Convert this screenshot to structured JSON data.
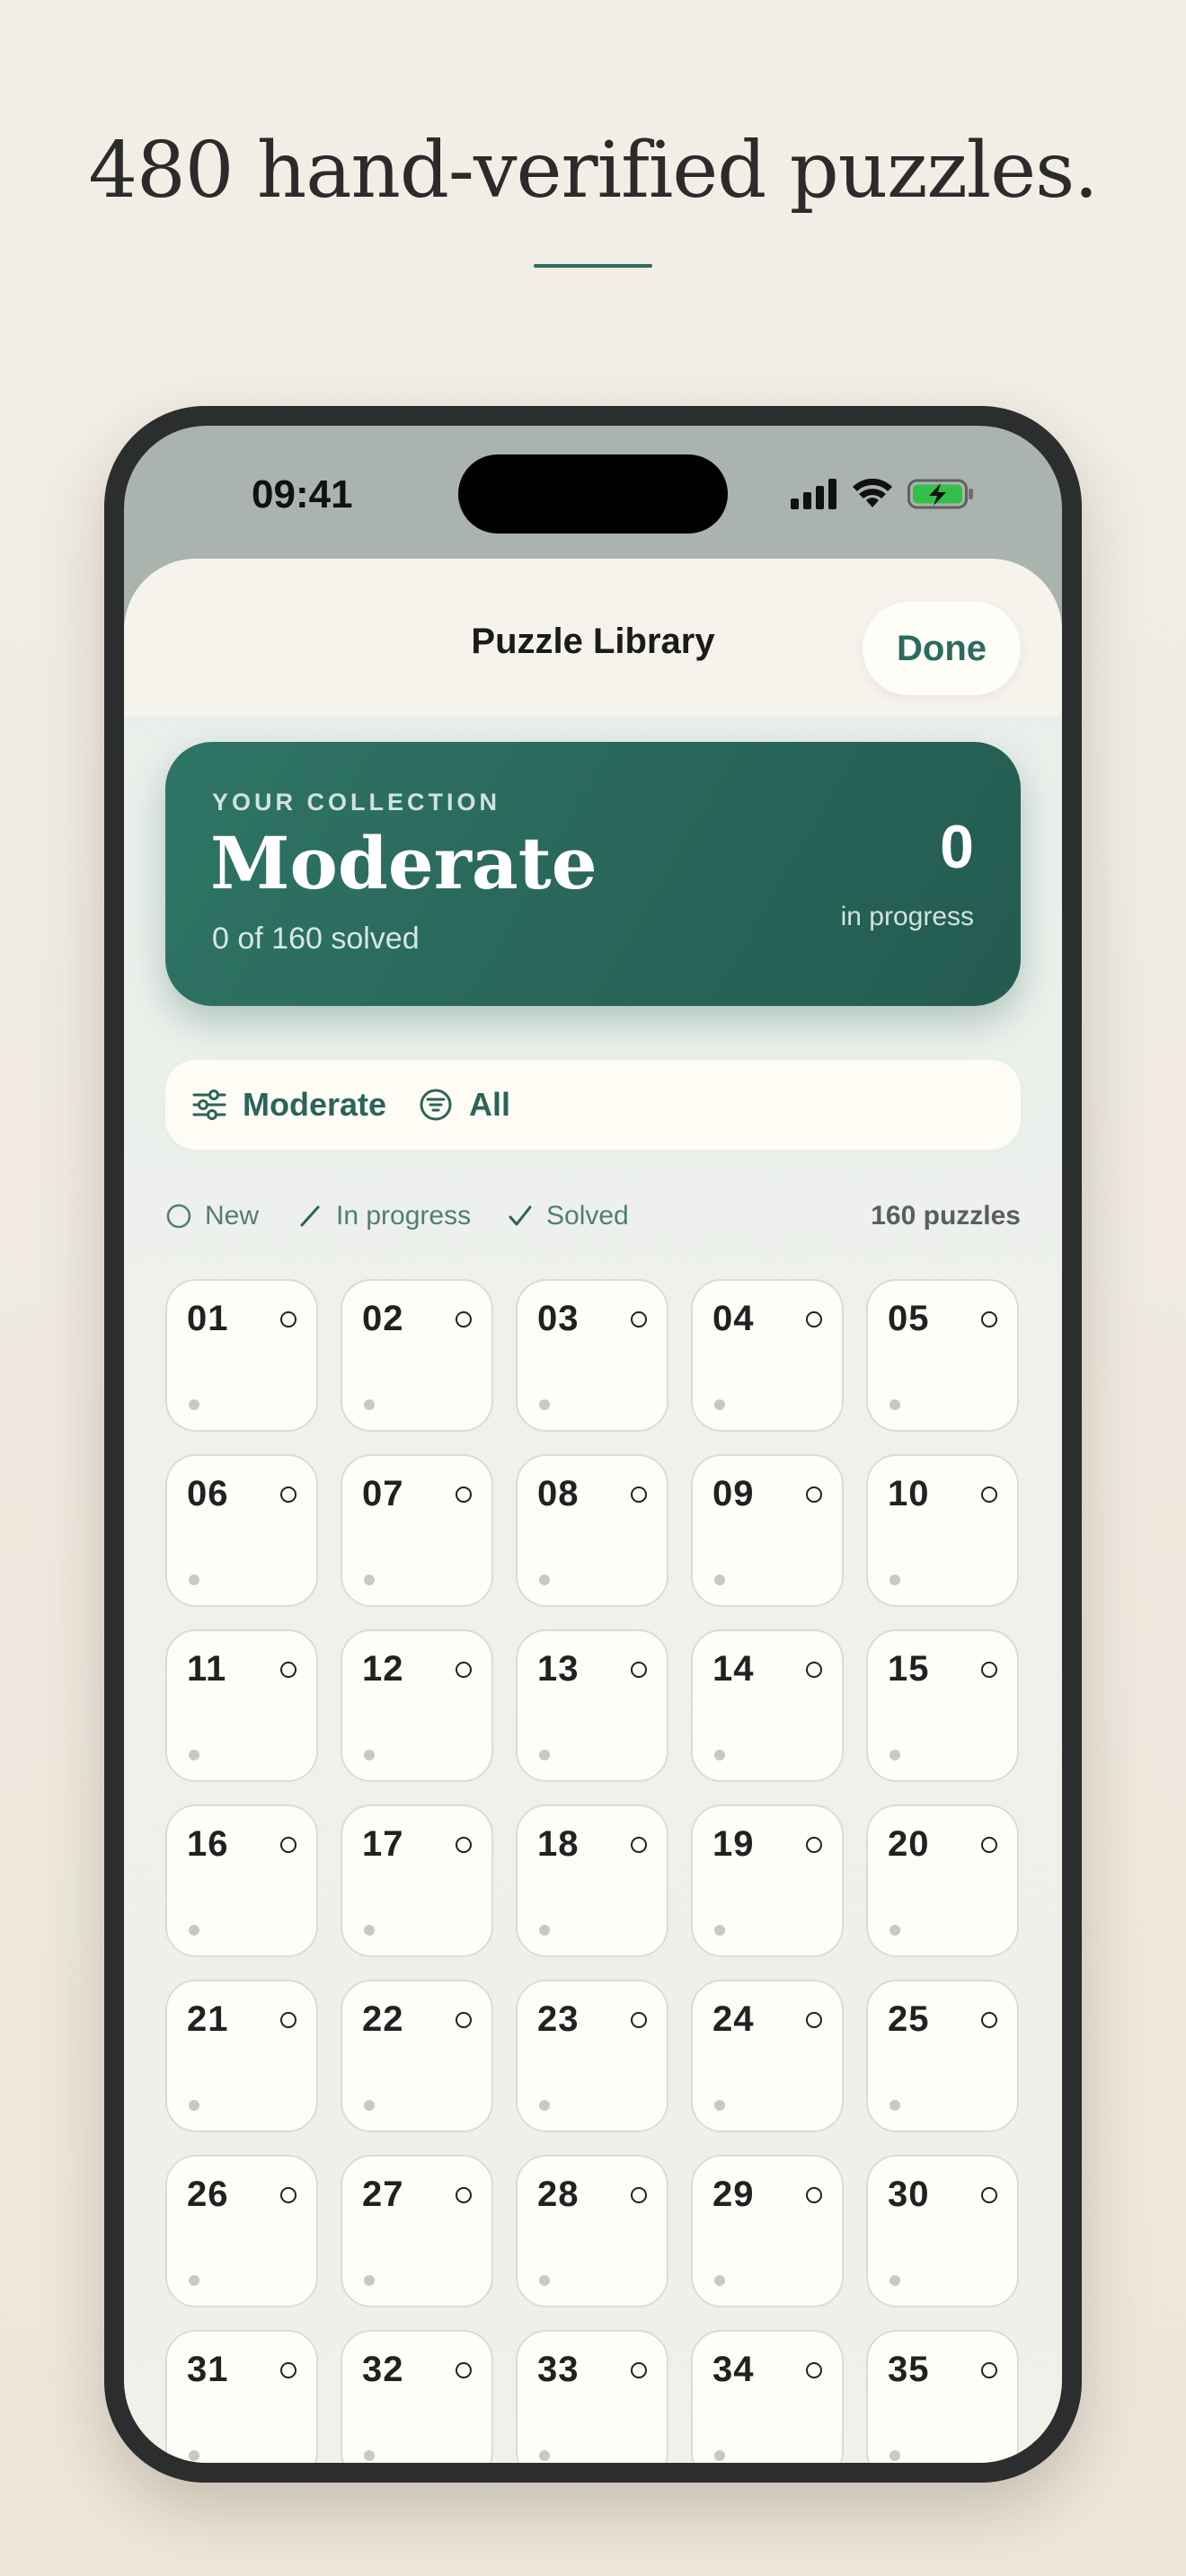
{
  "headline": "480 hand-verified puzzles.",
  "status_bar": {
    "time": "09:41",
    "icons": [
      "signal-icon",
      "wifi-icon",
      "battery-charging-icon"
    ]
  },
  "sheet": {
    "title": "Puzzle Library",
    "done_label": "Done"
  },
  "collection_card": {
    "eyebrow": "YOUR COLLECTION",
    "title": "Moderate",
    "subtitle": "0 of 160 solved",
    "count": "0",
    "count_label": "in progress"
  },
  "filters": {
    "difficulty": "Moderate",
    "status": "All"
  },
  "legend": {
    "new": "New",
    "in_progress": "In progress",
    "solved": "Solved",
    "count": "160 puzzles"
  },
  "puzzles": [
    "01",
    "02",
    "03",
    "04",
    "05",
    "06",
    "07",
    "08",
    "09",
    "10",
    "11",
    "12",
    "13",
    "14",
    "15",
    "16",
    "17",
    "18",
    "19",
    "20",
    "21",
    "22",
    "23",
    "24",
    "25",
    "26",
    "27",
    "28",
    "29",
    "30",
    "31",
    "32",
    "33",
    "34",
    "35"
  ],
  "colors": {
    "accent": "#2c6b5f",
    "card": "#286659",
    "background": "#f1ede4"
  }
}
